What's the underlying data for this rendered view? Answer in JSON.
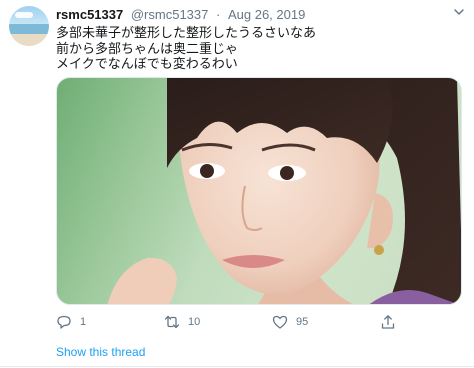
{
  "tweet": {
    "display_name": "rsmc51337",
    "handle": "@rsmc51337",
    "separator": "·",
    "date": "Aug 26, 2019",
    "text_lines": [
      "多部未華子が整形した整形したうるさいなあ",
      "前から多部ちゃんは奥二重じゃ",
      "メイクでなんぼでも変わるわい"
    ]
  },
  "actions": {
    "reply_count": "1",
    "retweet_count": "10",
    "like_count": "95"
  },
  "show_thread": "Show this thread",
  "icons": {
    "reply": "reply-icon",
    "retweet": "retweet-icon",
    "like": "heart-icon",
    "share": "share-icon",
    "more": "chevron-down-icon"
  },
  "colors": {
    "link": "#1da1f2",
    "secondary": "#657786"
  }
}
